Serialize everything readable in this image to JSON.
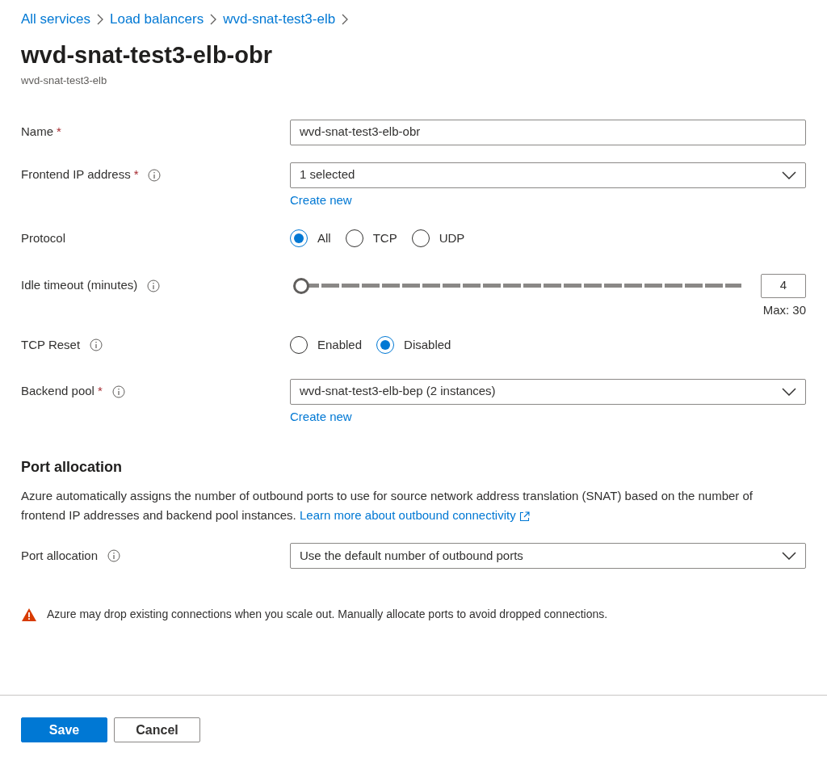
{
  "breadcrumb": [
    {
      "label": "All services"
    },
    {
      "label": "Load balancers"
    },
    {
      "label": "wvd-snat-test3-elb"
    }
  ],
  "title": "wvd-snat-test3-elb-obr",
  "subtitle": "wvd-snat-test3-elb",
  "fields": [
    {
      "kind": "text",
      "label": "Name",
      "required_mark": "*",
      "info": false,
      "value": "wvd-snat-test3-elb-obr"
    },
    {
      "kind": "dropdown",
      "label": "Frontend IP address",
      "required_mark": "*",
      "info": true,
      "value": "1 selected",
      "link": "Create new"
    },
    {
      "kind": "radio",
      "label": "Protocol",
      "info": false,
      "options": [
        {
          "label": "All",
          "selected": true
        },
        {
          "label": "TCP",
          "selected": false
        },
        {
          "label": "UDP",
          "selected": false
        }
      ]
    },
    {
      "kind": "slider",
      "label": "Idle timeout (minutes)",
      "info": true,
      "level": 0,
      "value": "4",
      "max_label": "Max: 30"
    },
    {
      "kind": "radio",
      "label": "TCP Reset",
      "info": true,
      "options": [
        {
          "label": "Enabled",
          "selected": false
        },
        {
          "label": "Disabled",
          "selected": true
        }
      ]
    },
    {
      "kind": "dropdown",
      "label": "Backend pool",
      "required_mark": "*",
      "info": true,
      "value": "wvd-snat-test3-elb-bep (2 instances)",
      "link": "Create new"
    }
  ],
  "port_section": {
    "heading": "Port allocation",
    "description": "Azure automatically assigns the number of outbound ports to use for source network address translation (SNAT) based on the number of frontend IP addresses and backend pool instances.",
    "link": "Learn more about outbound connectivity",
    "fields": [
      {
        "kind": "dropdown",
        "label": "Port allocation",
        "info": true,
        "value": "Use the default number of outbound ports"
      }
    ]
  },
  "warning": "Azure may drop existing connections when you scale out. Manually allocate ports to avoid dropped connections.",
  "buttons": [
    {
      "label": "Save",
      "kind": "primary"
    },
    {
      "label": "Cancel",
      "kind": "secondary"
    }
  ]
}
